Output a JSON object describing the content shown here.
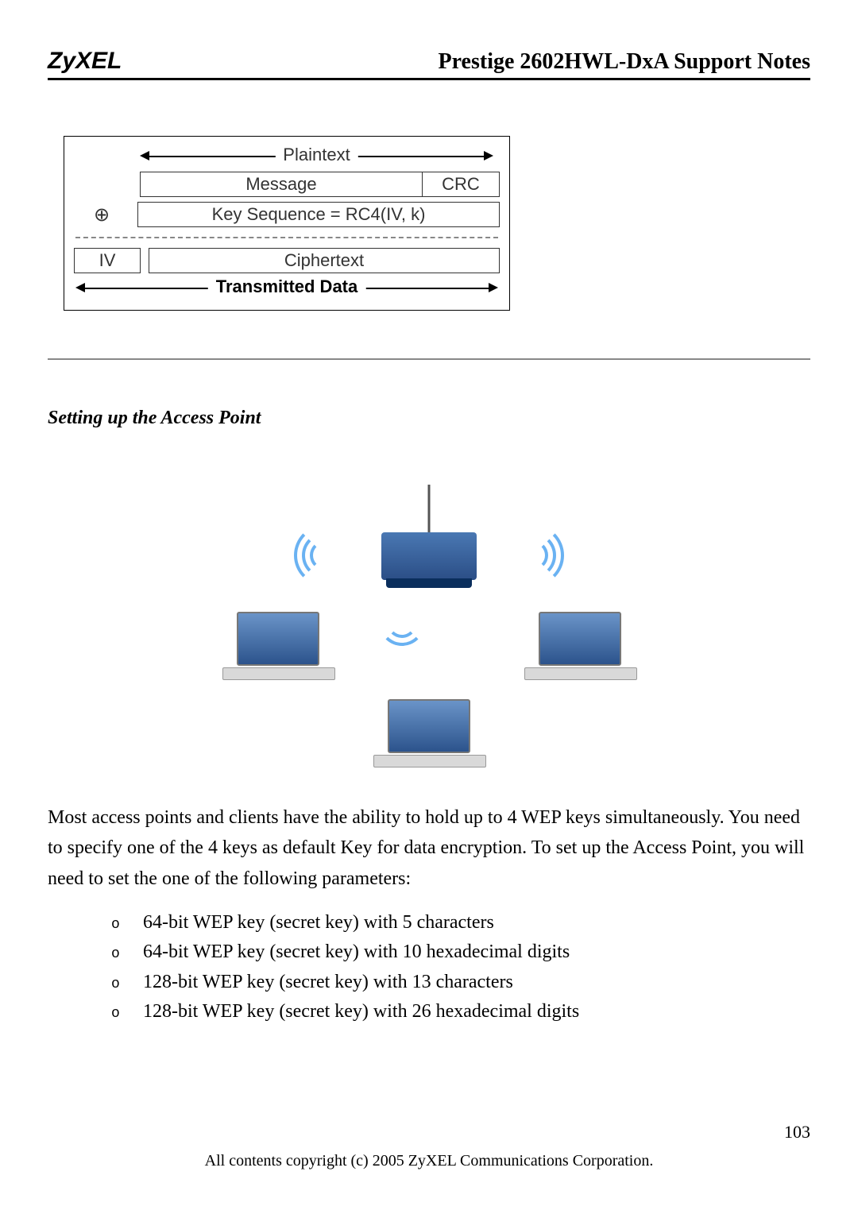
{
  "header": {
    "logo_text": "ZyXEL",
    "doc_title": "Prestige 2602HWL-DxA Support Notes"
  },
  "diagram": {
    "plaintext_label": "Plaintext",
    "message_label": "Message",
    "crc_label": "CRC",
    "xor_symbol": "⊕",
    "keyseq_label": "Key Sequence = RC4(IV, k)",
    "iv_label": "IV",
    "ciphertext_label": "Ciphertext",
    "transmitted_label": "Transmitted Data"
  },
  "section": {
    "heading": "Setting up the Access Point"
  },
  "body": {
    "paragraph": "Most access points and clients have the ability to hold up to 4 WEP keys simultaneously. You need to specify one of the 4 keys as default Key for data encryption. To set up the Access Point, you will need to set the one of the following parameters:",
    "bullets": [
      "64-bit WEP key (secret key) with 5 characters",
      "64-bit WEP key (secret key) with 10 hexadecimal digits",
      "128-bit WEP key (secret key) with 13 characters",
      "128-bit WEP key (secret key) with 26 hexadecimal digits"
    ]
  },
  "footer": {
    "page_number": "103",
    "copyright": "All contents copyright (c) 2005 ZyXEL Communications Corporation."
  }
}
